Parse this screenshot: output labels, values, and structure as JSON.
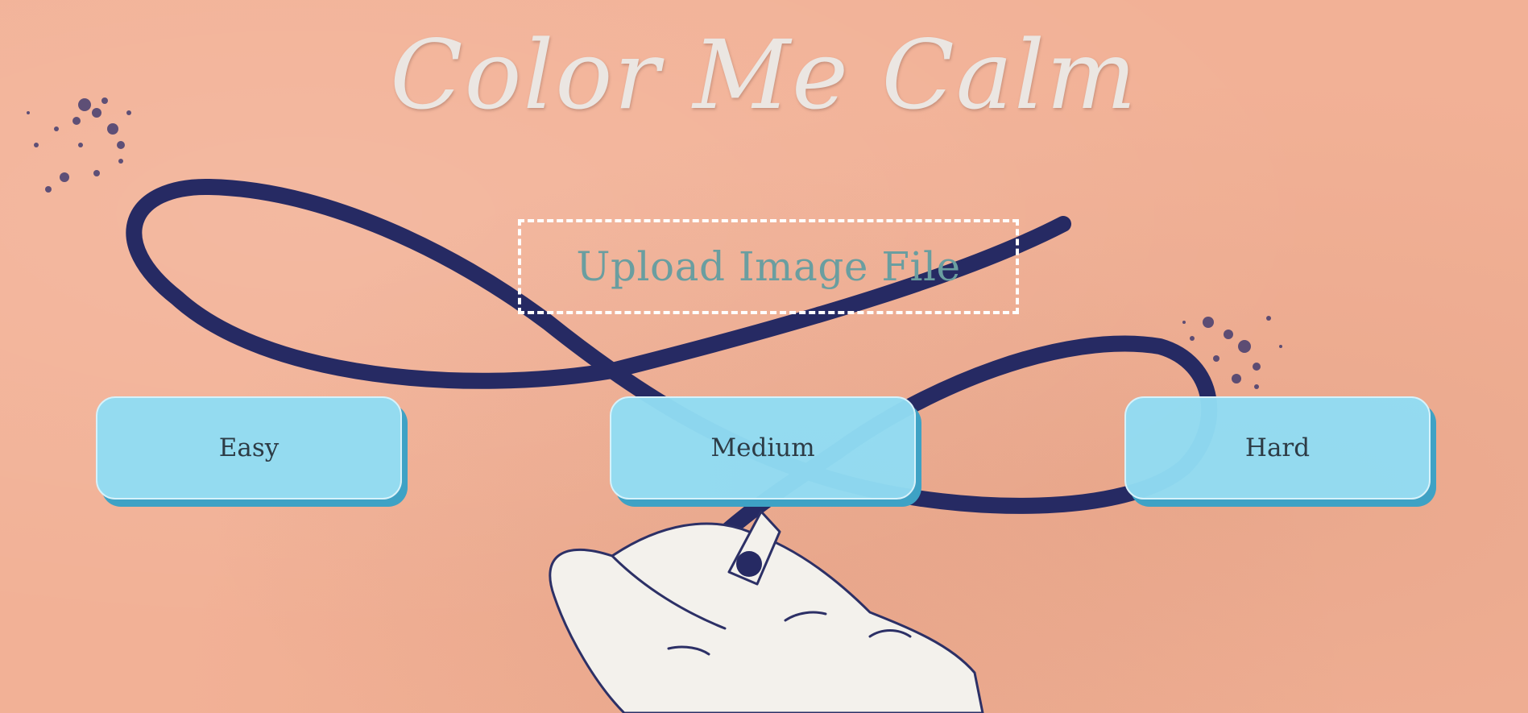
{
  "header": {
    "title": "Color Me Calm"
  },
  "upload": {
    "label": "Upload Image File"
  },
  "difficulty": {
    "buttons": [
      {
        "label": "Easy"
      },
      {
        "label": "Medium"
      },
      {
        "label": "Hard"
      }
    ]
  },
  "background": {
    "base": "#f2b196",
    "ribbon": "#262a63",
    "hand": "#f3f1ec"
  },
  "theme": {
    "title": "#ebe6e2",
    "upload_text": "#6a9ea0",
    "button_fill": "#91dcf3",
    "button_shadow": "#3ea2c5",
    "button_text": "#2d3b45"
  }
}
